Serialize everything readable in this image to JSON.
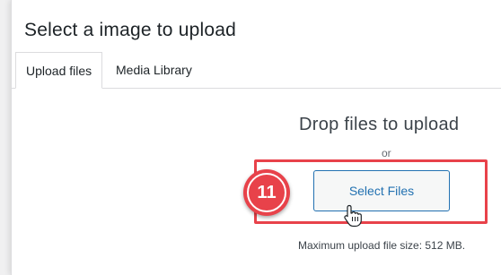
{
  "modal": {
    "title": "Select a image to upload"
  },
  "tabs": [
    {
      "label": "Upload files"
    },
    {
      "label": "Media Library"
    }
  ],
  "uploader": {
    "drop_text": "Drop files to upload",
    "or_text": "or",
    "button_label": "Select Files",
    "max_size_text": "Maximum upload file size: 512 MB."
  },
  "annotation": {
    "step_number": "11",
    "color": "#e8424a"
  },
  "icons": {
    "cursor": "hand-pointer-icon"
  }
}
